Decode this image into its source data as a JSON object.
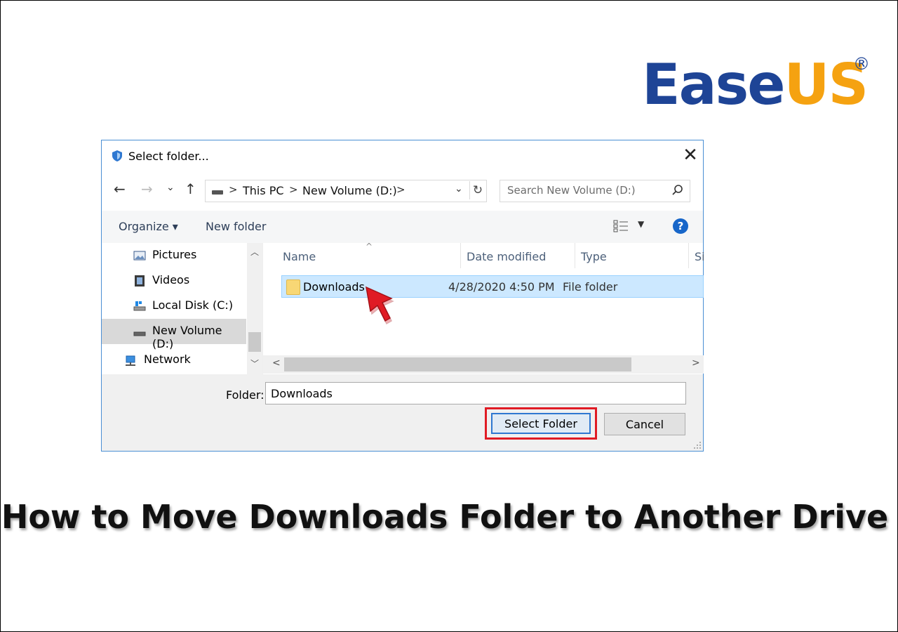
{
  "logo": {
    "part1": "Ease",
    "part2": "US",
    "registered": "®",
    "colors": {
      "blue": "#1e4496",
      "orange": "#f5a211"
    }
  },
  "dialog": {
    "title": "Select folder...",
    "close_glyph": "✕",
    "nav": {
      "back": "←",
      "forward": "→",
      "recent": "⌄",
      "up": "↑"
    },
    "address": {
      "crumbs": [
        "This PC",
        "New Volume (D:)"
      ],
      "separator": ">",
      "dropdown": "⌄",
      "refresh": "↻"
    },
    "search": {
      "placeholder": "Search New Volume (D:)",
      "icon": "search-icon"
    },
    "toolbar": {
      "organize": "Organize ▾",
      "new_folder": "New folder",
      "help": "?"
    },
    "sidebar": {
      "items": [
        {
          "label": "Pictures",
          "icon": "pictures-icon"
        },
        {
          "label": "Videos",
          "icon": "videos-icon"
        },
        {
          "label": "Local Disk (C:)",
          "icon": "local-disk-icon"
        },
        {
          "label": "New Volume (D:)",
          "icon": "drive-icon",
          "selected": true
        },
        {
          "label": "Network",
          "icon": "network-icon"
        }
      ]
    },
    "columns": [
      "Name",
      "Date modified",
      "Type",
      "Si"
    ],
    "rows": [
      {
        "name": "Downloads",
        "date": "4/28/2020 4:50 PM",
        "type": "File folder",
        "selected": true
      }
    ],
    "folder_label": "Folder:",
    "folder_value": "Downloads",
    "select_button": "Select Folder",
    "cancel_button": "Cancel",
    "colors": {
      "highlight": "#e01b24",
      "selection": "#cce8ff",
      "accent": "#2f78d1"
    }
  },
  "caption": "How to Move Downloads Folder to Another Drive"
}
